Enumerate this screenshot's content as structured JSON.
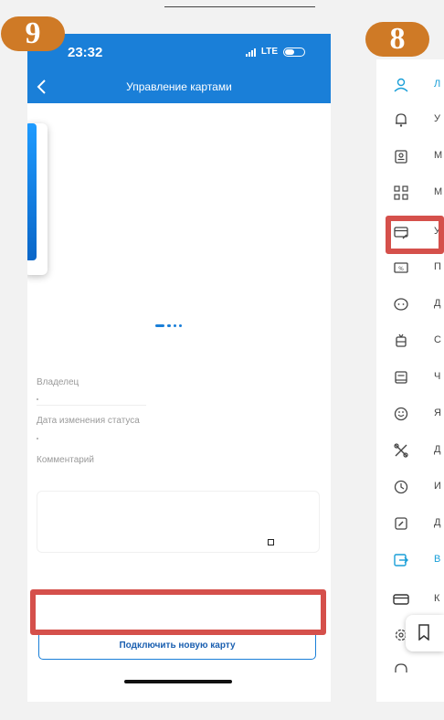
{
  "badges": {
    "left": "9",
    "right": "8"
  },
  "status_bar": {
    "time": "23:32",
    "network": "LTE"
  },
  "nav": {
    "title": "Управление картами"
  },
  "details": {
    "owner_label": "Владелец",
    "status_date_label": "Дата изменения статуса",
    "comment_label": "Комментарий"
  },
  "connect_button": {
    "label": "Подключить новую карту"
  },
  "menu": {
    "items": [
      {
        "icon": "profile-icon",
        "label": "Л",
        "accent": true
      },
      {
        "icon": "bell-icon",
        "label": "У"
      },
      {
        "icon": "id-badge-icon",
        "label": "М"
      },
      {
        "icon": "qr-code-icon",
        "label": "М"
      },
      {
        "icon": "card-edit-icon",
        "label": "У"
      },
      {
        "icon": "discount-card-icon",
        "label": "П"
      },
      {
        "icon": "face-icon",
        "label": "Д"
      },
      {
        "icon": "trolleybus-icon",
        "label": "С"
      },
      {
        "icon": "book-icon",
        "label": "Ч"
      },
      {
        "icon": "smile-icon",
        "label": "Я"
      },
      {
        "icon": "tools-icon",
        "label": "Д"
      },
      {
        "icon": "history-icon",
        "label": "И"
      },
      {
        "icon": "edit-square-icon",
        "label": "Д"
      },
      {
        "icon": "logout-icon",
        "label": "В",
        "accent": true
      },
      {
        "icon": "card-icon",
        "label": "К"
      },
      {
        "icon": "settings-icon",
        "label": ""
      },
      {
        "icon": "support-icon",
        "label": ""
      }
    ]
  },
  "colors": {
    "primary": "#1a7fd8",
    "highlight": "#d5504b",
    "badge": "#cf7a26"
  }
}
